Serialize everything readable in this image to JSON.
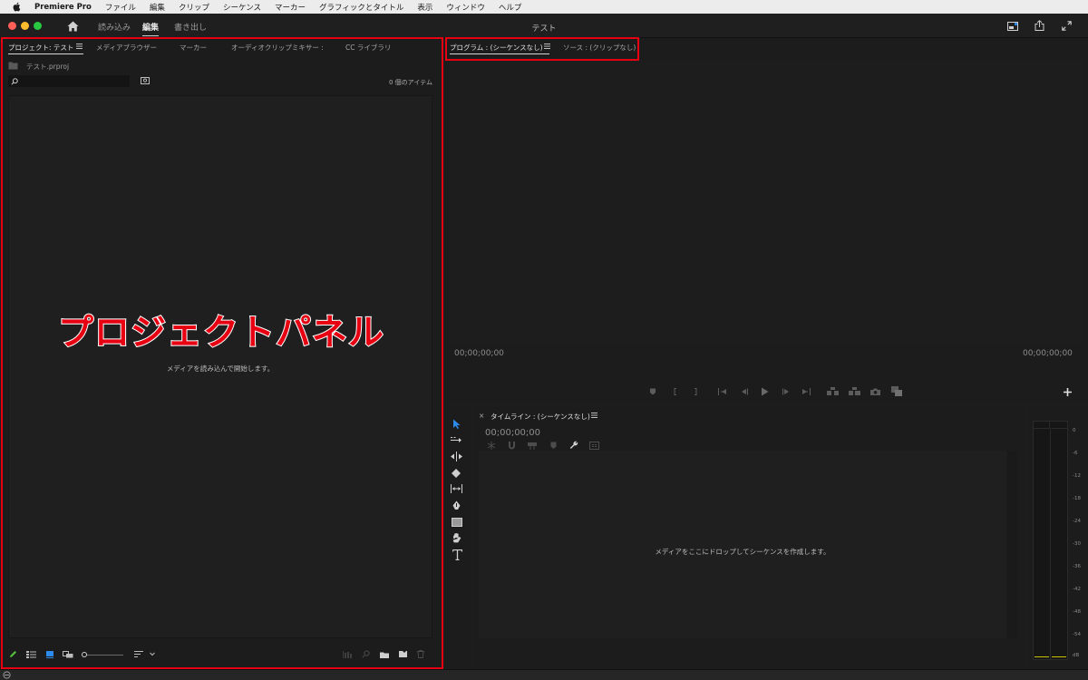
{
  "menubar": {
    "app_name": "Premiere Pro",
    "items": [
      "ファイル",
      "編集",
      "クリップ",
      "シーケンス",
      "マーカー",
      "グラフィックとタイトル",
      "表示",
      "ウィンドウ",
      "ヘルプ"
    ]
  },
  "titlebar": {
    "title": "テスト",
    "workspace_tabs": [
      {
        "label": "読み込み",
        "active": false
      },
      {
        "label": "編集",
        "active": true
      },
      {
        "label": "書き出し",
        "active": false
      }
    ]
  },
  "project_panel": {
    "tabs": [
      {
        "label": "プロジェクト: テスト",
        "active": true
      },
      {
        "label": "メディアブラウザー",
        "active": false
      },
      {
        "label": "マーカー",
        "active": false
      },
      {
        "label": "オーディオクリップミキサー :",
        "active": false
      },
      {
        "label": "CC ライブラリ",
        "active": false
      }
    ],
    "file_name": "テスト.prproj",
    "search_placeholder": "",
    "item_count": "0 個のアイテム",
    "empty_hint": "メディアを読み込んで開始します。",
    "annotation": "プロジェクトパネル"
  },
  "monitor_panel": {
    "tabs": [
      {
        "label": "プログラム : (シーケンスなし)",
        "active": true
      },
      {
        "label": "ソース : (クリップなし)",
        "active": false
      }
    ],
    "timecode_in": "00;00;00;00",
    "timecode_out": "00;00;00;00"
  },
  "timeline_panel": {
    "close_glyph": "×",
    "tab_label": "タイムライン : (シーケンスなし)",
    "timecode": "00;00;00;00",
    "empty_hint": "メディアをここにドロップしてシーケンスを作成します。"
  },
  "audio_meter": {
    "scale": [
      "0",
      "-6",
      "-12",
      "-18",
      "-24",
      "-30",
      "-36",
      "-42",
      "-48",
      "-54",
      "dB"
    ]
  },
  "colors": {
    "accent_blue": "#2d8ceb",
    "annotation_red": "#e60012",
    "meter_level": "#c9c400"
  }
}
